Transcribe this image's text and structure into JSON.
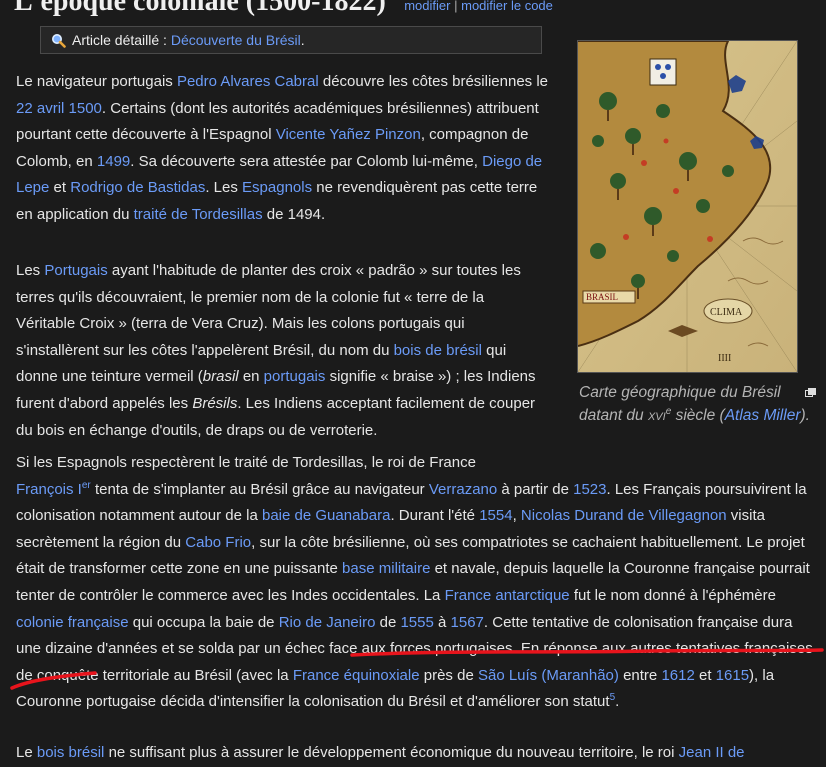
{
  "section": {
    "title": "L'époque coloniale (1500-1822)",
    "edit": "modifier",
    "separator": "|",
    "edit_code": "modifier le code"
  },
  "hatnote": {
    "prefix": "Article détaillé :",
    "link": "Découverte du Brésil",
    "suffix": "."
  },
  "figure": {
    "map_label_brasil": "BRASIL",
    "map_label_clima": "CLIMA",
    "map_label_iiii": "IIII",
    "caption_1": "Carte géographique du Brésil datant du",
    "caption_century": "xvi",
    "caption_sup": "e",
    "caption_2": "siècle (",
    "caption_link": "Atlas Miller",
    "caption_3": ")."
  },
  "p1": {
    "t1": "Le navigateur portugais",
    "l1": "Pedro Alvares Cabral",
    "t2": "découvre les côtes brésiliennes le",
    "l2": "22 avril 1500",
    "t3": ". Certains (dont les autorités académiques brésiliennes) attribuent pourtant cette découverte à l'Espagnol",
    "l3": "Vicente Yañez Pinzon",
    "t4": ", compagnon de Colomb, en",
    "l4": "1499",
    "t5": ". Sa découverte sera attestée par Colomb lui-même,",
    "l5": "Diego de Lepe",
    "t6": "et",
    "l6": "Rodrigo de Bastidas",
    "t7": ". Les",
    "l7": "Espagnols",
    "t8": "ne revendiquèrent pas cette terre en application du",
    "l8": "traité de Tordesillas",
    "t9": "de 1494."
  },
  "p2": {
    "t1": "Les",
    "l1": "Portugais",
    "t2": "ayant l'habitude de planter des croix « padrão » sur toutes les terres qu'ils découvraient, le premier nom de la colonie fut « terre de la Véritable Croix » (terra de Vera Cruz). Mais les colons portugais qui s'installèrent sur les côtes l'appelèrent Brésil, du nom du",
    "l2": "bois de brésil",
    "t3": "qui donne une teinture vermeil (",
    "i1": "brasil",
    "t4": "en",
    "l3": "portugais",
    "t5": "signifie « braise ») ; les Indiens furent d'abord appelés les",
    "i2": "Brésils",
    "t6": ". Les Indiens acceptant facilement de couper du bois en échange d'outils, de draps ou de verroterie."
  },
  "p3": {
    "t1": "Si les Espagnols respectèrent le traité de Tordesillas, le roi de France",
    "l1": "François I",
    "l1_sup": "er",
    "t2": "tenta de s'implanter au Brésil grâce au navigateur",
    "l2": "Verrazano",
    "t3": "à partir de",
    "l3": "1523",
    "t4": ". Les Français poursuivirent la colonisation notamment autour de la",
    "l4": "baie de Guanabara",
    "t5": ". Durant l'été",
    "l5": "1554",
    "t6": ",",
    "l6": "Nicolas Durand de Villegagnon",
    "t7": "visita secrètement la région du",
    "l7": "Cabo Frio",
    "t8": ", sur la côte brésilienne, où ses compatriotes se cachaient habituellement. Le projet était de transformer cette zone en une puissante",
    "l8": "base militaire",
    "t9": "et navale, depuis laquelle la Couronne française pourrait tenter de contrôler le commerce avec les Indes occidentales. La",
    "l9": "France antarctique",
    "t10": "fut le nom donné à l'éphémère",
    "l10": "colonie française",
    "t11": "qui occupa la baie de",
    "l11": "Rio de Janeiro",
    "t12": "de",
    "l12": "1555",
    "t13": "à",
    "l13": "1567",
    "t14": ". Cette tentative de colonisation française dura une dizaine d'années et se solda par un échec face aux forces portugaises. En réponse aux autres tentatives françaises de conquête territoriale au Brésil (avec la",
    "l14": "France équinoxiale",
    "t15": "près de",
    "l15": "São Luís (Maranhão)",
    "t16": "entre",
    "l16": "1612",
    "t17": "et",
    "l17": "1615",
    "t18": "), la Couronne portugaise décida d'intensifier la colonisation du Brésil et d'améliorer son statut",
    "ref": "5",
    "t19": "."
  },
  "p4": {
    "t1": "Le",
    "l1": "bois brésil",
    "t2": "ne suffisant plus à assurer le développement économique du nouveau territoire, le roi",
    "l2": "Jean II de"
  },
  "colors": {
    "background": "#1b1b1b",
    "link": "#6b9bf7",
    "text": "#e6e6e6",
    "underline": "#e8141c"
  }
}
